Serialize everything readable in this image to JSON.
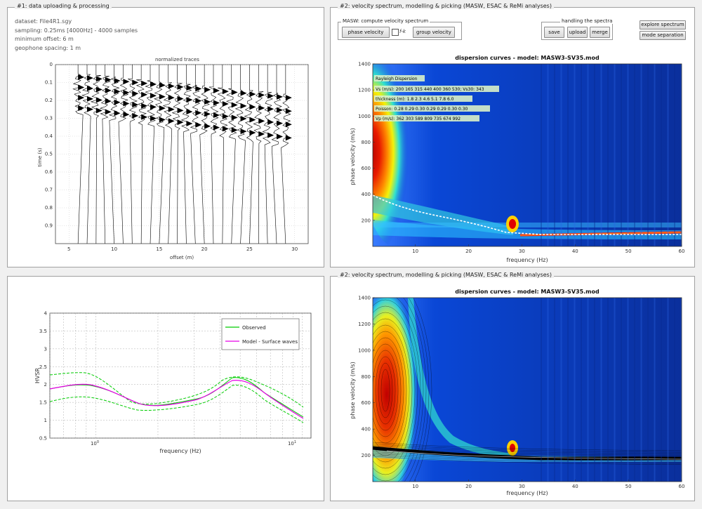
{
  "panel1": {
    "title": "#1: data uploading & processing",
    "info": [
      "dataset: File4R1.sgy",
      "sampling: 0.25ms [4000Hz] - 4000 samples",
      "minimum offset: 6 m",
      "geophone spacing: 1 m"
    ],
    "plot": {
      "title": "normalized traces",
      "xlabel": "offset (m)",
      "ylabel": "time (s)",
      "xticks": [
        "5",
        "10",
        "15",
        "20",
        "25",
        "30"
      ],
      "yticks": [
        "0",
        "0.1",
        "0.2",
        "0.3",
        "0.4",
        "0.5",
        "0.6",
        "0.7",
        "0.8",
        "0.9"
      ]
    }
  },
  "panel2": {
    "title": "#2: velocity spectrum, modelling & picking (MASW, ESAC & ReMi analyses)",
    "masw_group": "MASW: compute velocity spectrum",
    "phase_velocity_btn": "phase velocity",
    "fk_label": "f-k",
    "group_velocity_btn": "group velocity",
    "spectra_group": "handling the spectra",
    "save_btn": "save",
    "upload_btn": "upload",
    "merge_btn": "merge",
    "explore_btn": "explore spectrum",
    "mode_sep_btn": "mode separation",
    "plot": {
      "title": "dispersion curves - model: MASW3-SV35.mod",
      "xlabel": "frequency (Hz)",
      "ylabel": "phase velocity (m/s)",
      "xticks": [
        "10",
        "20",
        "30",
        "40",
        "50",
        "60"
      ],
      "yticks": [
        "200",
        "400",
        "600",
        "800",
        "1000",
        "1200",
        "1400"
      ]
    },
    "legend": {
      "header": "Rayleigh Dispersion",
      "vs": "Vs (m/s): 200  165  315  440  400  360  530; Vs30: 343",
      "thickness": "thickness (m): 1.8   2.3   4.6   5.1   7.8   6.0",
      "poisson": "Poisson: 0.28  0.29  0.30  0.29  0.29  0.30  0.30",
      "vp": "Vp (m/s): 362  303  589  809  735  674  992"
    }
  },
  "panel3": {
    "plot": {
      "xlabel": "frequency (Hz)",
      "ylabel": "HVSR",
      "yticks": [
        "0.5",
        "1",
        "1.5",
        "2",
        "2.5",
        "3",
        "3.5",
        "4"
      ],
      "xticks": [
        "10^0",
        "10^1"
      ]
    },
    "legend": {
      "observed": "Observed",
      "model": "Model - Surface waves"
    },
    "colors": {
      "observed": "#00cc00",
      "model": "#e600e6"
    }
  },
  "panel4": {
    "title": "#2: velocity spectrum, modelling & picking (MASW, ESAC & ReMi analyses)",
    "plot": {
      "title": "dispersion curves - model: MASW3-SV35.mod",
      "xlabel": "frequency (Hz)",
      "ylabel": "phase velocity (m/s)",
      "xticks": [
        "10",
        "20",
        "30",
        "40",
        "50",
        "60"
      ],
      "yticks": [
        "200",
        "400",
        "600",
        "800",
        "1000",
        "1200",
        "1400"
      ]
    }
  }
}
